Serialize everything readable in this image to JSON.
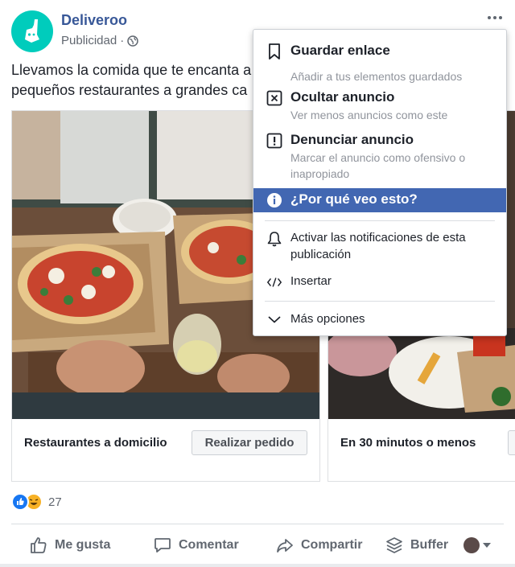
{
  "post": {
    "page_name": "Deliveroo",
    "sponsored": "Publicidad",
    "sponsored_sep": "·",
    "text_line1": "Llevamos la comida que te encanta a",
    "text_line2": "pequeños restaurantes a grandes ca"
  },
  "carousel": {
    "cards": [
      {
        "title": "Restaurantes a domicilio",
        "cta": "Realizar pedido"
      },
      {
        "title": "En 30 minutos o menos"
      }
    ]
  },
  "reactions": {
    "count": "27"
  },
  "actions": {
    "like": "Me gusta",
    "comment": "Comentar",
    "share": "Compartir",
    "buffer": "Buffer"
  },
  "menu": {
    "save_title": "Guardar enlace",
    "save_sub": "Añadir a tus elementos guardados",
    "hide_title": "Ocultar anuncio",
    "hide_sub": "Ver menos anuncios como este",
    "report_title": "Denunciar anuncio",
    "report_sub": "Marcar el anuncio como ofensivo o inapropiado",
    "why_title": "¿Por qué veo esto?",
    "notify": "Activar las notificaciones de esta publicación",
    "embed": "Insertar",
    "more": "Más opciones"
  },
  "colors": {
    "brand": "#00ccbc",
    "link": "#385898",
    "menu_highlight": "#4267b2"
  }
}
